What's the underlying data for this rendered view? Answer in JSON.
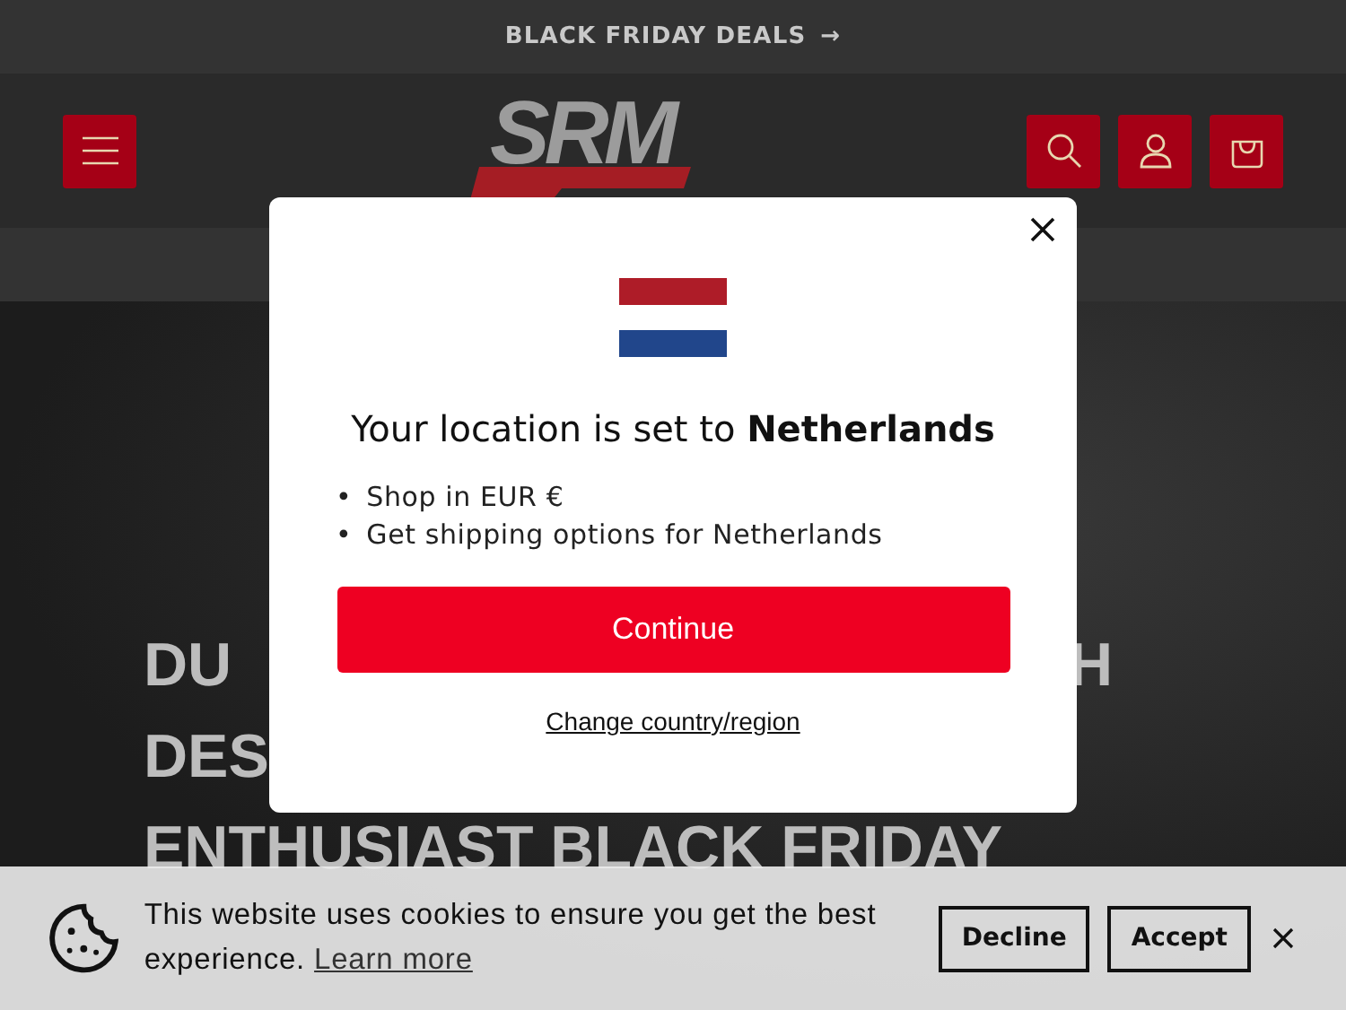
{
  "announcement": {
    "text": "BLACK FRIDAY DEALS",
    "arrow": "→"
  },
  "header": {
    "logo": "SRM"
  },
  "hero": {
    "lines": [
      [
        "DU",
        "H"
      ],
      [
        "DES"
      ],
      [
        "ENTHUSIAST BLACK FRIDAY"
      ]
    ]
  },
  "modal": {
    "title": "Your location is set to **Netherlands**",
    "marker": "•",
    "bullets": [
      "Shop in EUR €",
      "Get shipping options for Netherlands"
    ],
    "button": "Continue",
    "link": "Change country/region"
  },
  "cookie_banner": {
    "text": "This website uses cookies to ensure you get the best experience.",
    "link": "Learn more",
    "buttons": [
      "Decline",
      "Accept"
    ]
  }
}
